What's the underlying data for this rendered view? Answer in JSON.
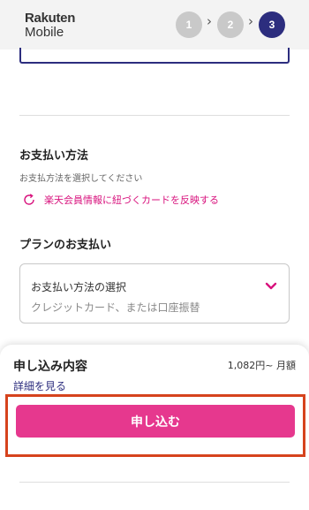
{
  "header": {
    "logo_line1": "Rakuten",
    "logo_line2": "Mobile",
    "steps": [
      "1",
      "2",
      "3"
    ],
    "active_step": "3"
  },
  "payment_method": {
    "heading": "お支払い方法",
    "subtext": "お支払方法を選択してください",
    "reflect_link": "楽天会員情報に紐づくカードを反映する"
  },
  "plan_payment": {
    "heading": "プランのお支払い",
    "select_label": "お支払い方法の選択",
    "select_placeholder": "クレジットカード、または口座振替"
  },
  "summary": {
    "title": "申し込み内容",
    "price": "1,082円~ 月額",
    "details_link": "詳細を見る",
    "apply_label": "申し込む"
  },
  "colors": {
    "brand_dark": "#2c2d7e",
    "accent_pink": "#e6388e",
    "link_pink": "#d8127d",
    "highlight": "#d6431d"
  },
  "icons": [
    "refresh-icon",
    "chevron-down-icon",
    "chevron-right-icon"
  ]
}
